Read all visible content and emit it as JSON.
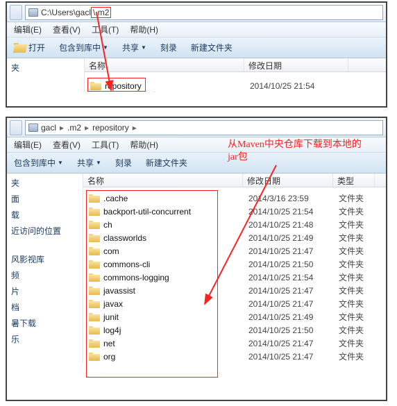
{
  "win1": {
    "address_path": "C:\\Users\\gacl\\.m2",
    "menus": [
      "编辑(E)",
      "查看(V)",
      "工具(T)",
      "帮助(H)"
    ],
    "toolbar": {
      "open": "打开",
      "include": "包含到库中",
      "share": "共享",
      "burn": "刻录",
      "newfolder": "新建文件夹"
    },
    "columns": {
      "name": "名称",
      "date": "修改日期"
    },
    "sidebar": [
      "夹"
    ],
    "rows": [
      {
        "name": "repository",
        "date": "2014/10/25 21:54"
      }
    ]
  },
  "win2": {
    "crumbs": [
      "gacl",
      ".m2",
      "repository"
    ],
    "menus": [
      "编辑(E)",
      "查看(V)",
      "工具(T)",
      "帮助(H)"
    ],
    "toolbar": {
      "include": "包含到库中",
      "share": "共享",
      "burn": "刻录",
      "newfolder": "新建文件夹"
    },
    "columns": {
      "name": "名称",
      "date": "修改日期",
      "type": "类型"
    },
    "sidebar": [
      "夹",
      "面",
      "载",
      "近访问的位置",
      "",
      "",
      "",
      "风影视库",
      "频",
      "片",
      "档",
      "暑下载",
      "乐"
    ],
    "rows": [
      {
        "name": ".cache",
        "date": "2014/3/16 23:59",
        "type": "文件夹"
      },
      {
        "name": "backport-util-concurrent",
        "date": "2014/10/25 21:54",
        "type": "文件夹"
      },
      {
        "name": "ch",
        "date": "2014/10/25 21:48",
        "type": "文件夹"
      },
      {
        "name": "classworlds",
        "date": "2014/10/25 21:49",
        "type": "文件夹"
      },
      {
        "name": "com",
        "date": "2014/10/25 21:47",
        "type": "文件夹"
      },
      {
        "name": "commons-cli",
        "date": "2014/10/25 21:50",
        "type": "文件夹"
      },
      {
        "name": "commons-logging",
        "date": "2014/10/25 21:54",
        "type": "文件夹"
      },
      {
        "name": "javassist",
        "date": "2014/10/25 21:47",
        "type": "文件夹"
      },
      {
        "name": "javax",
        "date": "2014/10/25 21:47",
        "type": "文件夹"
      },
      {
        "name": "junit",
        "date": "2014/10/25 21:49",
        "type": "文件夹"
      },
      {
        "name": "log4j",
        "date": "2014/10/25 21:50",
        "type": "文件夹"
      },
      {
        "name": "net",
        "date": "2014/10/25 21:47",
        "type": "文件夹"
      },
      {
        "name": "org",
        "date": "2014/10/25 21:47",
        "type": "文件夹"
      }
    ]
  },
  "annotation": {
    "line1": "从Maven中央仓库下载到本地的",
    "line2": "jar包"
  }
}
